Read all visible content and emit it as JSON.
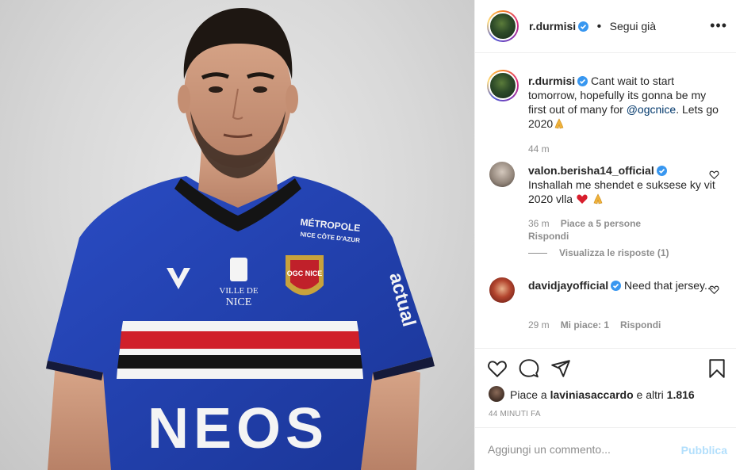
{
  "post_owner": {
    "username": "r.durmisi",
    "verified": true,
    "separator": "•",
    "follow_status": "Segui già",
    "more_icon": "more-horizontal-icon"
  },
  "caption": {
    "username": "r.durmisi",
    "text_before": "Cant wait to start tomorrow, hopefully its gonna be my first out of many for ",
    "mention": "@ogcnice",
    "text_after": ". Lets go 2020",
    "emoji": "folded-hands-emoji",
    "time": "44 m"
  },
  "comments": [
    {
      "username": "valon.berisha14_official",
      "verified": true,
      "text": "Inshallah me shendet e suksese ky vit 2020 vlla",
      "emojis": [
        "red-heart-emoji",
        "folded-hands-emoji"
      ],
      "time": "36 m",
      "likes": "Piace a 5 persone",
      "reply": "Rispondi",
      "view_replies": "Visualizza le risposte (1)"
    },
    {
      "username": "davidjayofficial",
      "verified": true,
      "text": "Need that jersey....",
      "time": "29 m",
      "likes": "Mi piace: 1",
      "reply": "Rispondi"
    }
  ],
  "actions": {
    "like_icon": "heart-icon",
    "comment_icon": "comment-icon",
    "share_icon": "share-icon",
    "save_icon": "bookmark-icon"
  },
  "likes_summary": {
    "prefix": "Piace a ",
    "user": "laviniasaccardo",
    "suffix": " e altri ",
    "count": "1.816"
  },
  "posted_ago": "44 minuti fa",
  "add_comment": {
    "placeholder": "Aggiungi un commento...",
    "publish": "Pubblica"
  },
  "jersey": {
    "sponsor_top_line1": "MÉTROPOLE",
    "sponsor_top_line2": "NICE CÔTE D'AZUR",
    "city_line1": "VILLE DE",
    "city_line2": "NICE",
    "crest_text": "OGC NICE",
    "sleeve_text": "actual",
    "main_sponsor": "NEOS"
  },
  "colors": {
    "jersey_blue": "#1f3fae",
    "stripe_red": "#d0202a",
    "stripe_black": "#141414",
    "verified_blue": "#3897f0",
    "link_blue": "#00376b",
    "publish_disabled": "#b2dffc"
  }
}
